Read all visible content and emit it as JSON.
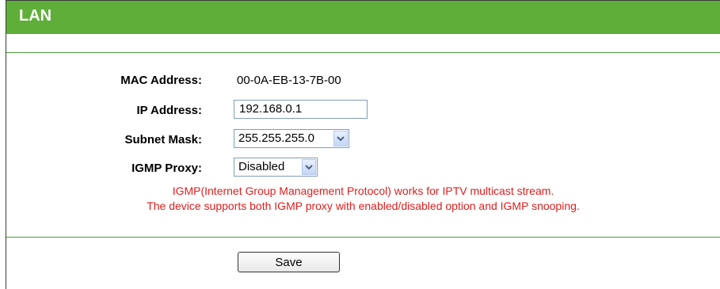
{
  "header": {
    "title": "LAN"
  },
  "form": {
    "mac": {
      "label": "MAC Address:",
      "value": "00-0A-EB-13-7B-00"
    },
    "ip": {
      "label": "IP Address:",
      "value": "192.168.0.1"
    },
    "subnet": {
      "label": "Subnet Mask:",
      "value": "255.255.255.0"
    },
    "igmp": {
      "label": "IGMP Proxy:",
      "value": "Disabled"
    }
  },
  "notes": {
    "line1": "IGMP(Internet Group Management Protocol) works for IPTV multicast stream.",
    "line2": "The device supports both IGMP proxy with enabled/disabled option and IGMP snooping."
  },
  "actions": {
    "save_label": "Save"
  },
  "colors": {
    "header": "#5fae3a",
    "note": "#e21d1d",
    "divider": "#4c9a3a"
  }
}
